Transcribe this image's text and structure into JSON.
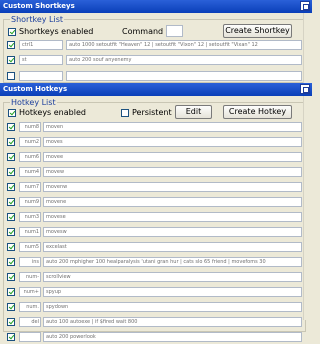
{
  "shortkeys": {
    "window_title": "Custom Shortkeys",
    "group_label": "Shortkey List",
    "enabled_label": "Shortkeys enabled",
    "command_label": "Command",
    "create_button": "Create Shortkey",
    "rows": [
      {
        "key": "ctrl1",
        "command": "auto 1000 setoutfit \"Heaven\" 12 | setoutfit \"Vixon\" 12 | setoutfit \"Vixan\" 12",
        "checked": true
      },
      {
        "key": "st",
        "command": "auto 200 souf anyenemy",
        "checked": true
      },
      {
        "key": "",
        "command": "",
        "checked": false
      }
    ]
  },
  "hotkeys": {
    "window_title": "Custom Hotkeys",
    "group_label": "Hotkey List",
    "enabled_label": "Hotkeys enabled",
    "persistent_label": "Persistent",
    "edit_button": "Edit",
    "create_button": "Create Hotkey",
    "rows": [
      {
        "key": "num8",
        "command": "moven",
        "checked": true
      },
      {
        "key": "num2",
        "command": "moves",
        "checked": true
      },
      {
        "key": "num6",
        "command": "movee",
        "checked": true
      },
      {
        "key": "num4",
        "command": "movew",
        "checked": true
      },
      {
        "key": "num7",
        "command": "movenw",
        "checked": true
      },
      {
        "key": "num9",
        "command": "movene",
        "checked": true
      },
      {
        "key": "num3",
        "command": "movese",
        "checked": true
      },
      {
        "key": "num1",
        "command": "movesw",
        "checked": true
      },
      {
        "key": "num5",
        "command": "excelast",
        "checked": true
      },
      {
        "key": "ins",
        "command": "auto 200 mphigher 100 healparalysis 'utani gran hur | cats slo 65 friend | movefoms 30",
        "checked": true
      },
      {
        "key": "num-",
        "command": "scrollview",
        "checked": true
      },
      {
        "key": "num+",
        "command": "spyup",
        "checked": true
      },
      {
        "key": "num.",
        "command": "spydown",
        "checked": true
      },
      {
        "key": "del",
        "command": "auto 100 autoexe | if $fired wait 800",
        "checked": true
      },
      {
        "key": "",
        "command": "auto 200 powerlook",
        "checked": true
      }
    ]
  }
}
